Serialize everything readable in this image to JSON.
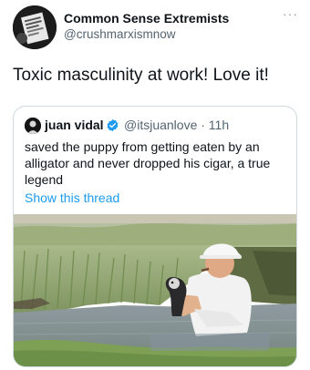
{
  "author": {
    "name": "Common Sense Extremists",
    "handle": "@crushmarxismnow",
    "more_icon": "ellipsis-icon",
    "more_glyph": "···"
  },
  "tweet": {
    "text": "Toxic masculinity at work! Love it!"
  },
  "quoted": {
    "name": "juan vidal",
    "handle_time": "@itsjuanlove · 11h",
    "verified_icon": "verified-badge-icon",
    "text": "saved the puppy from getting eaten by an alligator and never dropped his cigar, a true legend",
    "link": "Show this thread",
    "link_color": "#1d9bf0"
  },
  "colors": {
    "secondary_text": "#536471",
    "border": "#cfd9de",
    "verified": "#1d9bf0"
  }
}
